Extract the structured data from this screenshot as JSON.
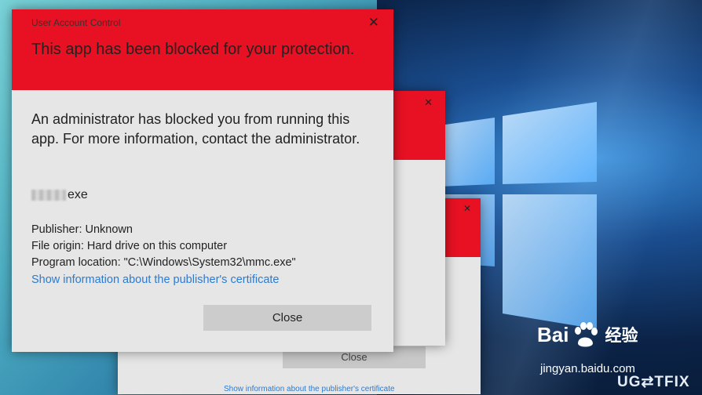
{
  "front_dialog": {
    "title": "User Account Control",
    "close_glyph": "✕",
    "heading": "This app has been blocked for your protection.",
    "message": "An administrator has blocked you from running this app. For more information, contact the administrator.",
    "file_name": "exe",
    "publisher": "Publisher: Unknown",
    "file_origin": "File origin: Hard drive on this computer",
    "program_location": "Program location: \"C:\\Windows\\System32\\mmc.exe\"",
    "cert_link": "Show information about the publisher's certificate",
    "close_button": "Close"
  },
  "middle_dialog": {
    "close_glyph": "✕"
  },
  "back_dialog": {
    "close_glyph": "✕",
    "close_button": "Close",
    "cert_link": "Show information about the publisher's certificate"
  },
  "watermark": {
    "baidu_logo": "Bai",
    "baidu_logo_end": "经验",
    "baidu_url": "jingyan.baidu.com",
    "ugetfix": "UG⇄TFIX"
  },
  "colors": {
    "alert_red": "#e81123",
    "link_blue": "#2b7bd0",
    "dialog_bg": "#e6e6e6"
  }
}
